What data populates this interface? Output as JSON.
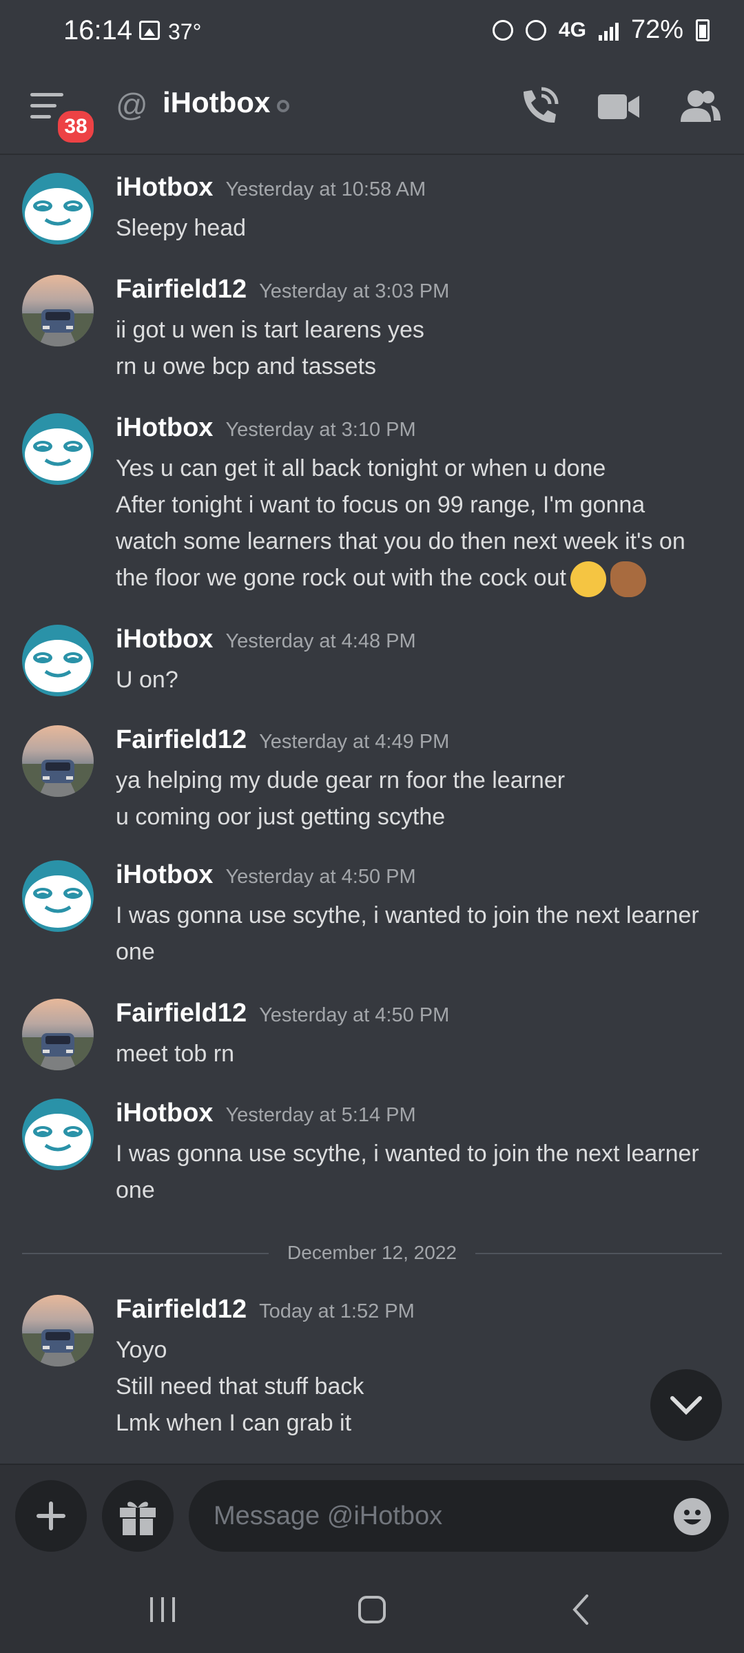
{
  "status_bar": {
    "time": "16:14",
    "temperature": "37°",
    "network": "4G",
    "battery": "72%"
  },
  "header": {
    "title": "iHotbox",
    "unread_badge": "38"
  },
  "messages": [
    {
      "author": "iHotbox",
      "time": "Yesterday at 10:58 AM",
      "avatar": "sloth",
      "lines": [
        "Sleepy head"
      ]
    },
    {
      "author": "Fairfield12",
      "time": "Yesterday at 3:03 PM",
      "avatar": "car",
      "lines": [
        "ii got u wen is tart learens yes",
        "rn u owe bcp and tassets"
      ]
    },
    {
      "author": "iHotbox",
      "time": "Yesterday at 3:10 PM",
      "avatar": "sloth",
      "lines": [
        "Yes u can get it all back tonight or when u done",
        "After tonight i want to focus on 99 range, I'm gonna",
        "watch some learners that you do then next week it's on",
        "the floor we gone rock out with the cock out"
      ]
    },
    {
      "author": "iHotbox",
      "time": "Yesterday at 4:48 PM",
      "avatar": "sloth",
      "lines": [
        "U on?"
      ]
    },
    {
      "author": "Fairfield12",
      "time": "Yesterday at 4:49 PM",
      "avatar": "car",
      "lines": [
        "ya helping my dude gear rn foor the learner",
        "u coming oor just getting scythe"
      ]
    },
    {
      "author": "iHotbox",
      "time": "Yesterday at 4:50 PM",
      "avatar": "sloth",
      "lines": [
        "I was gonna use scythe, i wanted to join the next learner",
        "one"
      ]
    },
    {
      "author": "Fairfield12",
      "time": "Yesterday at 4:50 PM",
      "avatar": "car",
      "lines": [
        "meet tob rn"
      ]
    },
    {
      "author": "iHotbox",
      "time": "Yesterday at 5:14 PM",
      "avatar": "sloth",
      "lines": [
        "I was gonna use scythe, i wanted to join the next learner",
        "one"
      ]
    },
    {
      "author": "Fairfield12",
      "time": "Today at 1:52 PM",
      "avatar": "car",
      "lines": [
        "Yoyo",
        "Still need that stuff back",
        "Lmk when I can grab it"
      ]
    }
  ],
  "date_divider": "December 12, 2022",
  "composer": {
    "placeholder": "Message @iHotbox"
  },
  "colors": {
    "background": "#36393f",
    "composer": "#2f3136",
    "badge": "#ed4245",
    "sloth": "#2a92a8"
  }
}
